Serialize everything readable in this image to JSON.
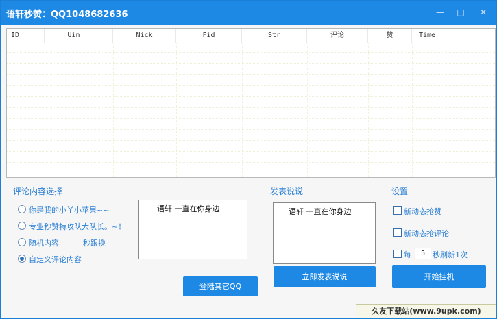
{
  "window": {
    "title": "语轩秒赞：QQ1048682636",
    "min_glyph": "—",
    "max_glyph": "□",
    "close_glyph": "✕"
  },
  "table": {
    "columns": [
      "ID",
      "Uin",
      "Nick",
      "Fid",
      "Str",
      "评论",
      "赞",
      "Time"
    ]
  },
  "comment_select": {
    "title": "评论内容选择",
    "options": [
      {
        "label": "你是我的小丫小苹果~~",
        "selected": false
      },
      {
        "label": "专业秒赞特攻队大队长。~！",
        "selected": false
      },
      {
        "label": "随机内容",
        "selected": false
      },
      {
        "label": "自定义评论内容",
        "selected": true
      }
    ],
    "random_note": "秒跟换",
    "textbox_value": "语轩  一直在你身边",
    "login_button": "登陆其它QQ"
  },
  "post": {
    "title": "发表说说",
    "textbox_value": "语轩  一直在你身边",
    "publish_button": "立即发表说说"
  },
  "settings": {
    "title": "设置",
    "checkbox_like": "新动态抢赞",
    "checkbox_comment": "新动态抢评论",
    "refresh_prefix": "每",
    "refresh_value": "5",
    "refresh_suffix": "秒刷新1次",
    "start_button": "开始挂机"
  },
  "watermark": "久友下载站(www.9upk.com)"
}
